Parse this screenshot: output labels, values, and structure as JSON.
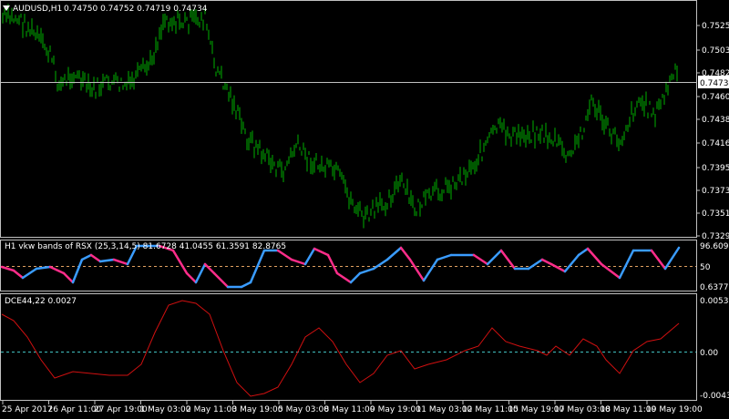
{
  "colors": {
    "background": "#000000",
    "frame": "#c0c0c0",
    "grid_text": "#ffffff",
    "candles": "#00b000",
    "rsx_up": "#3a9cff",
    "rsx_down": "#ff2d8a",
    "rsx_level": "#e0a060",
    "dce_line": "#d01010",
    "zero_level": "#40c0c0",
    "price_label_bg": "#ffffff",
    "price_label_text": "#000000"
  },
  "main_pane": {
    "caption_icon": "triangle-down-icon",
    "symbol": "AUDUSD,H1",
    "quote": "0.74750 0.74752 0.74719 0.74734",
    "current_price": "0.74734",
    "price_ticks": [
      "0.75257",
      "0.75037",
      "0.74822",
      "0.74602",
      "0.74387",
      "0.74167",
      "0.73952",
      "0.73732",
      "0.73517",
      "0.73297"
    ]
  },
  "rsx_pane": {
    "caption": "H1 vkw bands of RSX (25,3,14,5) 81.6728 41.0455 61.3591 82.8765",
    "ticks": [
      "96.6091",
      "50",
      "0.6377"
    ]
  },
  "dce_pane": {
    "caption": "DCE44,22 0.0027",
    "ticks": [
      "0.0053",
      "0.00",
      "-0.0043"
    ]
  },
  "time_axis": {
    "labels": [
      "25 Apr 2017",
      "26 Apr 11:00",
      "27 Apr 19:00",
      "1 May 03:00",
      "2 May 11:00",
      "3 May 19:00",
      "5 May 03:00",
      "8 May 11:00",
      "9 May 19:00",
      "11 May 03:00",
      "12 May 11:00",
      "15 May 19:00",
      "17 May 03:00",
      "18 May 11:00",
      "19 May 19:00"
    ]
  }
}
